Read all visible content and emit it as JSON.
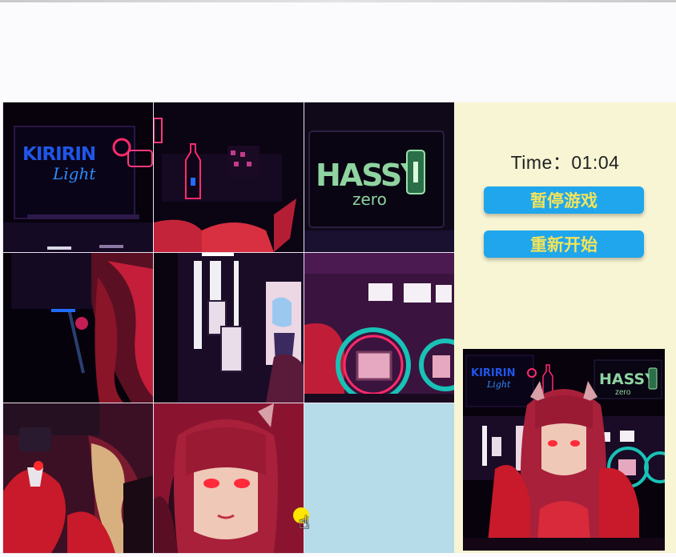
{
  "puzzle": {
    "empty_slot": 9,
    "tiles": [
      {
        "slot": 1,
        "sign": "KIRIRIN",
        "sign_script": "Light"
      },
      {
        "slot": 2
      },
      {
        "slot": 3,
        "sign": "HASSY",
        "sign_script": "zero"
      },
      {
        "slot": 4
      },
      {
        "slot": 5
      },
      {
        "slot": 6
      },
      {
        "slot": 7
      },
      {
        "slot": 8
      },
      {
        "slot": 9,
        "empty": true
      }
    ]
  },
  "sidebar": {
    "timer_label": "Time",
    "timer_separator": "：",
    "timer_value": "01:04",
    "pause_label": "暂停游戏",
    "restart_label": "重新开始"
  },
  "preview": {
    "sign_left": "KIRIRIN",
    "sign_left_script": "Light",
    "sign_right": "HASSY",
    "sign_right_script": "zero"
  },
  "colors": {
    "accent_button": "#1fa6ec",
    "button_text": "#f3e35a",
    "sidebar_bg": "#f7f5d4",
    "empty_tile": "#b6dbe9"
  }
}
